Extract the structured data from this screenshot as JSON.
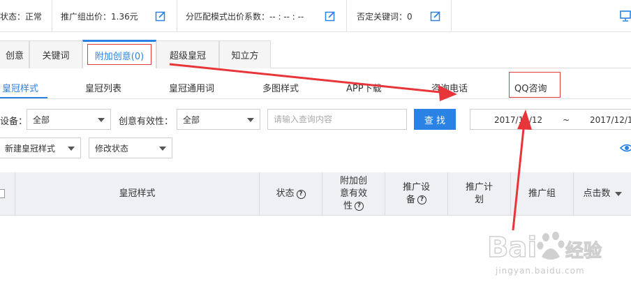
{
  "topbar": {
    "status_label": "状态：",
    "status_value": "正常",
    "bid_label": "推广组出价：1.36元",
    "match_label": "分匹配模式出价系数：-- : -- : --",
    "negative_label": "否定关键词：0"
  },
  "tabs": [
    {
      "label": "创意"
    },
    {
      "label": "关键词"
    },
    {
      "label": "附加创意(0)"
    },
    {
      "label": "超级皇冠"
    },
    {
      "label": "知立方"
    }
  ],
  "subtabs": [
    {
      "label": "皇冠样式"
    },
    {
      "label": "皇冠列表"
    },
    {
      "label": "皇冠通用词"
    },
    {
      "label": "多图样式"
    },
    {
      "label": "APP下载"
    },
    {
      "label": "咨询电话"
    },
    {
      "label": "QQ咨询"
    }
  ],
  "filters": {
    "device_label": "设备：",
    "device_value": "全部",
    "validity_label": "创意有效性：",
    "validity_value": "全部",
    "query_placeholder": "请输入查询内容",
    "search_button": "查 找",
    "date_start": "2017/11/12",
    "date_sep": "~",
    "date_end": "2017/12/1"
  },
  "actions": {
    "new_crown": "新建皇冠样式",
    "modify_status": "修改状态"
  },
  "table": {
    "headers": [
      {
        "label": "皇冠样式",
        "help": false
      },
      {
        "label": "状态",
        "help": true
      },
      {
        "label": "附加创\n意有效\n性",
        "help": true
      },
      {
        "label": "推广设\n备",
        "help": true
      },
      {
        "label": "推广计\n划",
        "help": false
      },
      {
        "label": "推广组",
        "help": false
      },
      {
        "label": "点击数",
        "help": false
      }
    ]
  },
  "watermark": {
    "url": "jingyan.baidu.com"
  },
  "colors": {
    "accent": "#2a82e4",
    "annotation": "#e8353a",
    "status_ok": "#2e9e3a"
  }
}
